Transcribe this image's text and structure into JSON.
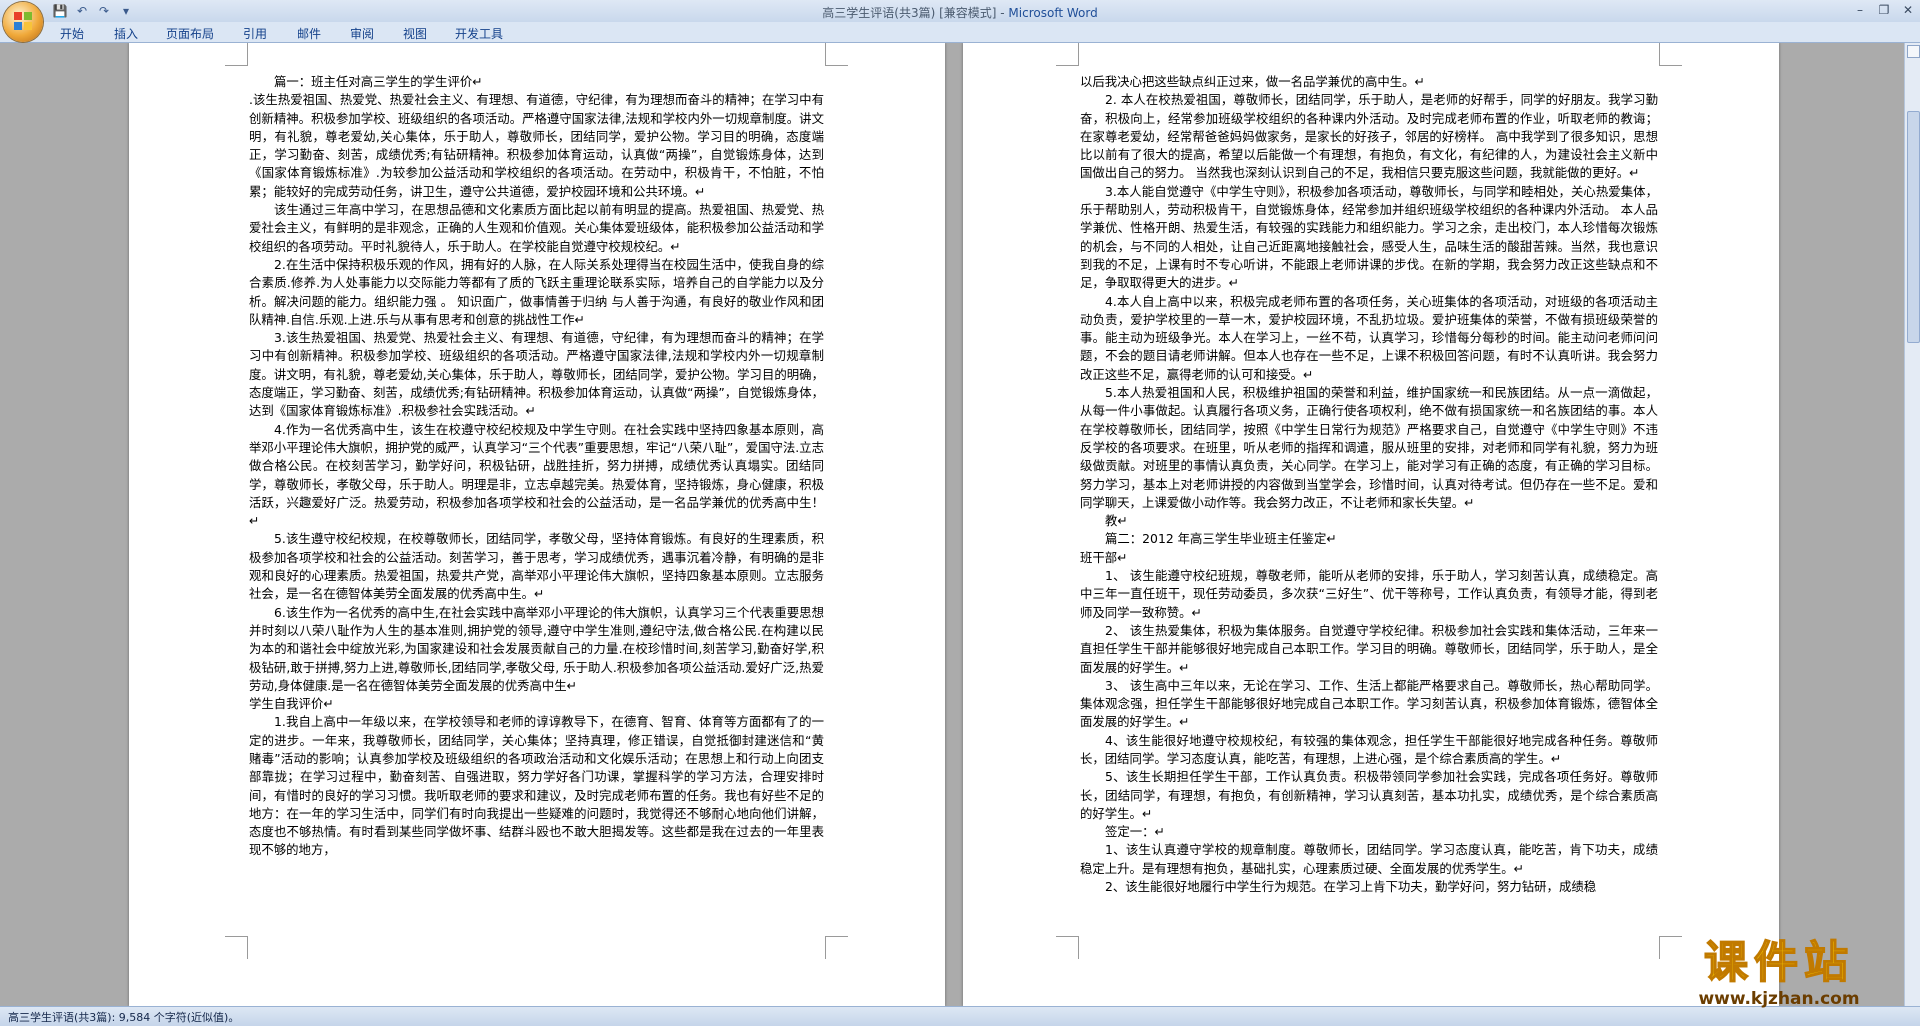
{
  "window": {
    "title_doc": "高三学生评语(共3篇) [兼容模式] - ",
    "title_app": "Microsoft Word",
    "controls": [
      "–",
      "❐",
      "✕"
    ]
  },
  "ribbon": {
    "tabs": [
      "开始",
      "插入",
      "页面布局",
      "引用",
      "邮件",
      "审阅",
      "视图",
      "开发工具"
    ],
    "help": "?"
  },
  "status": {
    "text": "高三学生评语(共3篇): 9,584 个字符(近似值)。"
  },
  "watermark": {
    "title": "课件站",
    "url": "www.kjzhan.com"
  },
  "document": {
    "left_page": [
      "篇一：班主任对高三学生的学生评价↵",
      ".该生热爱祖国、热爱党、热爱社会主义、有理想、有道德，守纪律，有为理想而奋斗的精神；在学习中有创新精神。积极参加学校、班级组织的各项活动。严格遵守国家法律,法规和学校内外一切规章制度。讲文明，有礼貌，尊老爱幼,关心集体，乐于助人，尊敬师长，团结同学，爱护公物。学习目的明确，态度端正，学习勤奋、刻苦，成绩优秀;有钻研精神。积极参加体育运动，认真做“两操”，自觉锻炼身体，达到《国家体育锻炼标准》.为较参加公益活动和学校组织的各项活动。在劳动中，积极肯干，不怕脏，不怕累；能较好的完成劳动任务，讲卫生，遵守公共道德，爱护校园环境和公共环境。↵",
      "该生通过三年高中学习，在思想品德和文化素质方面比起以前有明显的提高。热爱祖国、热爱党、热爱社会主义，有鲜明的是非观念，正确的人生观和价值观。关心集体爱班级体，能积极参加公益活动和学校组织的各项劳动。平时礼貌待人，乐于助人。在学校能自觉遵守校规校纪。↵",
      "2.在生活中保持积极乐观的作风，拥有好的人脉，在人际关系处理得当在校园生活中，使我自身的综合素质.修养.为人处事能力以交际能力等都有了质的飞跃主重理论联系实际，培养自己的自学能力以及分析。解决问题的能力。组织能力强 。 知识面广，做事情善于归纳 与人善于沟通，有良好的敬业作风和团队精神.自信.乐观.上进.乐与从事有思考和创意的挑战性工作↵",
      "3.该生热爱祖国、热爱党、热爱社会主义、有理想、有道德，守纪律，有为理想而奋斗的精神；在学习中有创新精神。积极参加学校、班级组织的各项活动。严格遵守国家法律,法规和学校内外一切规章制度。讲文明，有礼貌，尊老爱幼,关心集体，乐于助人，尊敬师长，团结同学，爱护公物。学习目的明确，态度端正，学习勤奋、刻苦，成绩优秀;有钻研精神。积极参加体育运动，认真做“两操”，自觉锻炼身体，达到《国家体育锻炼标准》.积极参社会实践活动。↵",
      "4.作为一名优秀高中生，该生在校遵守校纪校规及中学生守则。在社会实践中坚持四象基本原则，高举邓小平理论伟大旗帜，拥护党的威严，认真学习“三个代表”重要思想，牢记“八荣八耻”，爱国守法.立志做合格公民。在校刻苦学习，勤学好问，积极钻研，战胜挂折，努力拼搏，成绩优秀认真塌实。团结同学，尊敬师长，孝敬父母，乐于助人。明理是非，立志卓越完美。热爱体育，坚持锻炼，身心健康，积极活跃，兴趣爱好广泛。热爱劳动，积极参加各项学校和社会的公益活动，是一名品学兼优的优秀高中生！↵",
      "5.该生遵守校纪校规，在校尊敬师长，团结同学，孝敬父母，坚持体育锻炼。有良好的生理素质，积极参加各项学校和社会的公益活动。刻苦学习，善于思考，学习成绩优秀，遇事沉着冷静，有明确的是非观和良好的心理素质。热爱祖国，热爱共产党，高举邓小平理论伟大旗帜，坚持四象基本原则。立志服务社会，是一名在德智体美劳全面发展的优秀高中生。↵",
      "6.该生作为一名优秀的高中生,在社会实践中高举邓小平理论的伟大旗帜，认真学习三个代表重要思想并时刻以八荣八耻作为人生的基本准则,拥护党的领导,遵守中学生准则,遵纪守法,做合格公民.在构建以民为本的和谐社会中绽放光彩,为国家建设和社会发展贡献自己的力量.在校珍惜时间,刻苦学习,勤奋好学,积极钻研,敢于拼搏,努力上进,尊敬师长,团结同学,孝敬父母, 乐于助人.积极参加各项公益活动.爱好广泛,热爱劳动,身体健康.是一名在德智体美劳全面发展的优秀高中生↵",
      "学生自我评价↵",
      "1.我自上高中一年级以来，在学校领导和老师的谆谆教导下，在德育、智育、体育等方面都有了的一定的进步。一年来，我尊敬师长，团结同学，关心集体；坚持真理，修正错误，自觉抵御封建迷信和“黄赌毒”活动的影响；认真参加学校及班级组织的各项政治活动和文化娱乐活动；在思想上和行动上向团支部靠拢；在学习过程中，勤奋刻苦、自强进取，努力学好各门功课，掌握科学的学习方法，合理安排时间，有惜时的良好的学习习惯。我听取老师的要求和建议，及时完成老师布置的任务。我也有好些不足的地方：在一年的学习生活中，同学们有时向我提出一些疑难的问题时，我觉得还不够耐心地向他们讲解，态度也不够热情。有时看到某些同学做坏事、结群斗殴也不敢大胆揭发等。这些都是我在过去的一年里表现不够的地方，"
    ],
    "right_page": [
      "以后我决心把这些缺点纠正过来，做一名品学兼优的高中生。↵",
      "2. 本人在校热爱祖国，尊敬师长，团结同学，乐于助人，是老师的好帮手，同学的好朋友。我学习勤奋，积极向上，经常参加班级学校组织的各种课内外活动。及时完成老师布置的作业，听取老师的教诲；在家尊老爱幼，经常帮爸爸妈妈做家务，是家长的好孩子，邻居的好榜样。 高中我学到了很多知识，思想比以前有了很大的提高，希望以后能做一个有理想，有抱负，有文化，有纪律的人，为建设社会主义新中国做出自己的努力。 当然我也深刻认识到自己的不足，我相信只要克服这些问题，我就能做的更好。↵",
      "3.本人能自觉遵守《中学生守则》，积极参加各项活动，尊敬师长，与同学和睦相处，关心热爱集体，乐于帮助别人，劳动积极肯干，自觉锻炼身体，经常参加并组织班级学校组织的各种课内外活动。 本人品学兼优、性格开朗、热爱生活，有较强的实践能力和组织能力。学习之余，走出校门，本人珍惜每次锻炼的机会，与不同的人相处，让自己近距离地接触社会，感受人生，品味生活的酸甜苦辣。当然，我也意识到我的不足，上课有时不专心听讲，不能跟上老师讲课的步伐。在新的学期，我会努力改正这些缺点和不足，争取取得更大的进步。↵",
      "4.本人自上高中以来，积极完成老师布置的各项任务，关心班集体的各项活动，对班级的各项活动主动负责，爱护学校里的一草一木，爱护校园环境，不乱扔垃圾。爱护班集体的荣誉，不做有损班级荣誉的事。能主动为班级争光。本人在学习上，一丝不苟，认真学习，珍惜每分每秒的时间。能主动问老师问问题，不会的题目请老师讲解。但本人也存在一些不足，上课不积极回答问题，有时不认真听讲。我会努力改正这些不足，赢得老师的认可和接受。↵",
      "5.本人热爱祖国和人民，积极维护祖国的荣誉和利益，维护国家统一和民族团结。从一点一滴做起，从每一件小事做起。认真履行各项义务，正确行使各项权利，绝不做有损国家统一和名族团结的事。本人在学校尊敬师长，团结同学，按照《中学生日常行为规范》严格要求自己，自觉遵守《中学生守则》不违反学校的各项要求。在班里，听从老师的指挥和调遣，服从班里的安排，对老师和同学有礼貌，努力为班级做贡献。对班里的事情认真负责，关心同学。在学习上，能对学习有正确的态度，有正确的学习目标。努力学习，基本上对老师讲授的内容做到当堂学会，珍惜时间，认真对待考试。但仍存在一些不足。爱和同学聊天，上课爱做小动作等。我会努力改正，不让老师和家长失望。↵",
      "教↵",
      "篇二：2012 年高三学生毕业班主任鉴定↵",
      "班干部↵",
      "1、 该生能遵守校纪班规，尊敬老师，能听从老师的安排，乐于助人，学习刻苦认真，成绩稳定。高中三年一直任班干，现任劳动委员，多次获“三好生”、优干等称号，工作认真负责，有领导才能，得到老师及同学一致称赞。↵",
      "2、 该生热爱集体，积极为集体服务。自觉遵守学校纪律。积极参加社会实践和集体活动，三年来一直担任学生干部并能够很好地完成自己本职工作。学习目的明确。尊敬师长，团结同学，乐于助人，是全面发展的好学生。↵",
      "3、 该生高中三年以来，无论在学习、工作、生活上都能严格要求自己。尊敬师长，热心帮助同学。集体观念强，担任学生干部能够很好地完成自己本职工作。学习刻苦认真，积极参加体育锻炼，德智体全面发展的好学生。↵",
      "4、该生能很好地遵守校规校纪，有较强的集体观念，担任学生干部能很好地完成各种任务。尊敬师长，团结同学。学习态度认真，能吃苦，有理想，上进心强，是个综合素质高的学生。↵",
      "5、该生长期担任学生干部，工作认真负责。积极带领同学参加社会实践，完成各项任务好。尊敬师长，团结同学，有理想，有抱负，有创新精神，学习认真刻苦，基本功扎实，成绩优秀，是个综合素质高的好学生。↵",
      "签定一：↵",
      "1、该生认真遵守学校的规章制度。尊敬师长，团结同学。学习态度认真，能吃苦，肯下功夫，成绩稳定上升。是有理想有抱负，基础扎实，心理素质过硬、全面发展的优秀学生。↵",
      "2、该生能很好地履行中学生行为规范。在学习上肯下功夫，勤学好问，努力钻研，成绩稳"
    ]
  }
}
